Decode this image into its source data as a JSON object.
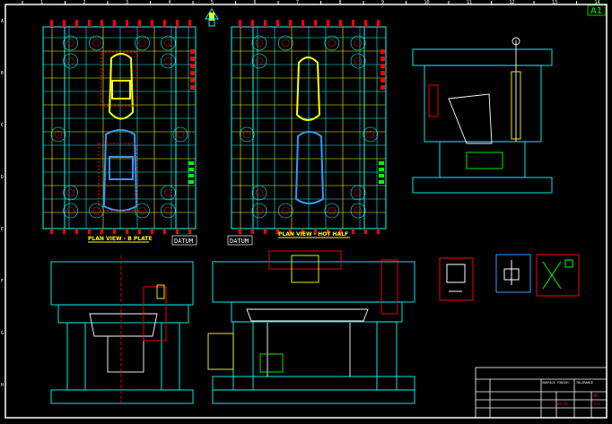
{
  "sheet": {
    "size_label": "A1",
    "column_ticks": [
      "1",
      "2",
      "3",
      "4",
      "5",
      "6",
      "7",
      "8",
      "9",
      "10",
      "11",
      "12",
      "13",
      "14"
    ],
    "row_ticks": [
      "A",
      "B",
      "C",
      "D",
      "E",
      "F",
      "G",
      "H"
    ]
  },
  "views": {
    "plan_left_title": "PLAN VIEW - B PLATE",
    "plan_right_title": "PLAN VIEW - HOT HALF",
    "datum_left": "DATUM",
    "datum_right": "DATUM"
  },
  "title_block": {
    "tolerance_header": "TOLERANCE",
    "surface_header": "SURFACE FINISH",
    "value_1": "±0.02",
    "value_2": "1/1",
    "value_3": "MM"
  },
  "colors": {
    "background": "#000000",
    "frame": "#ffffff",
    "cyan": "#00ffff",
    "yellow": "#ffff00",
    "red": "#ff0000",
    "green": "#00ff00",
    "blue": "#3399ff"
  }
}
